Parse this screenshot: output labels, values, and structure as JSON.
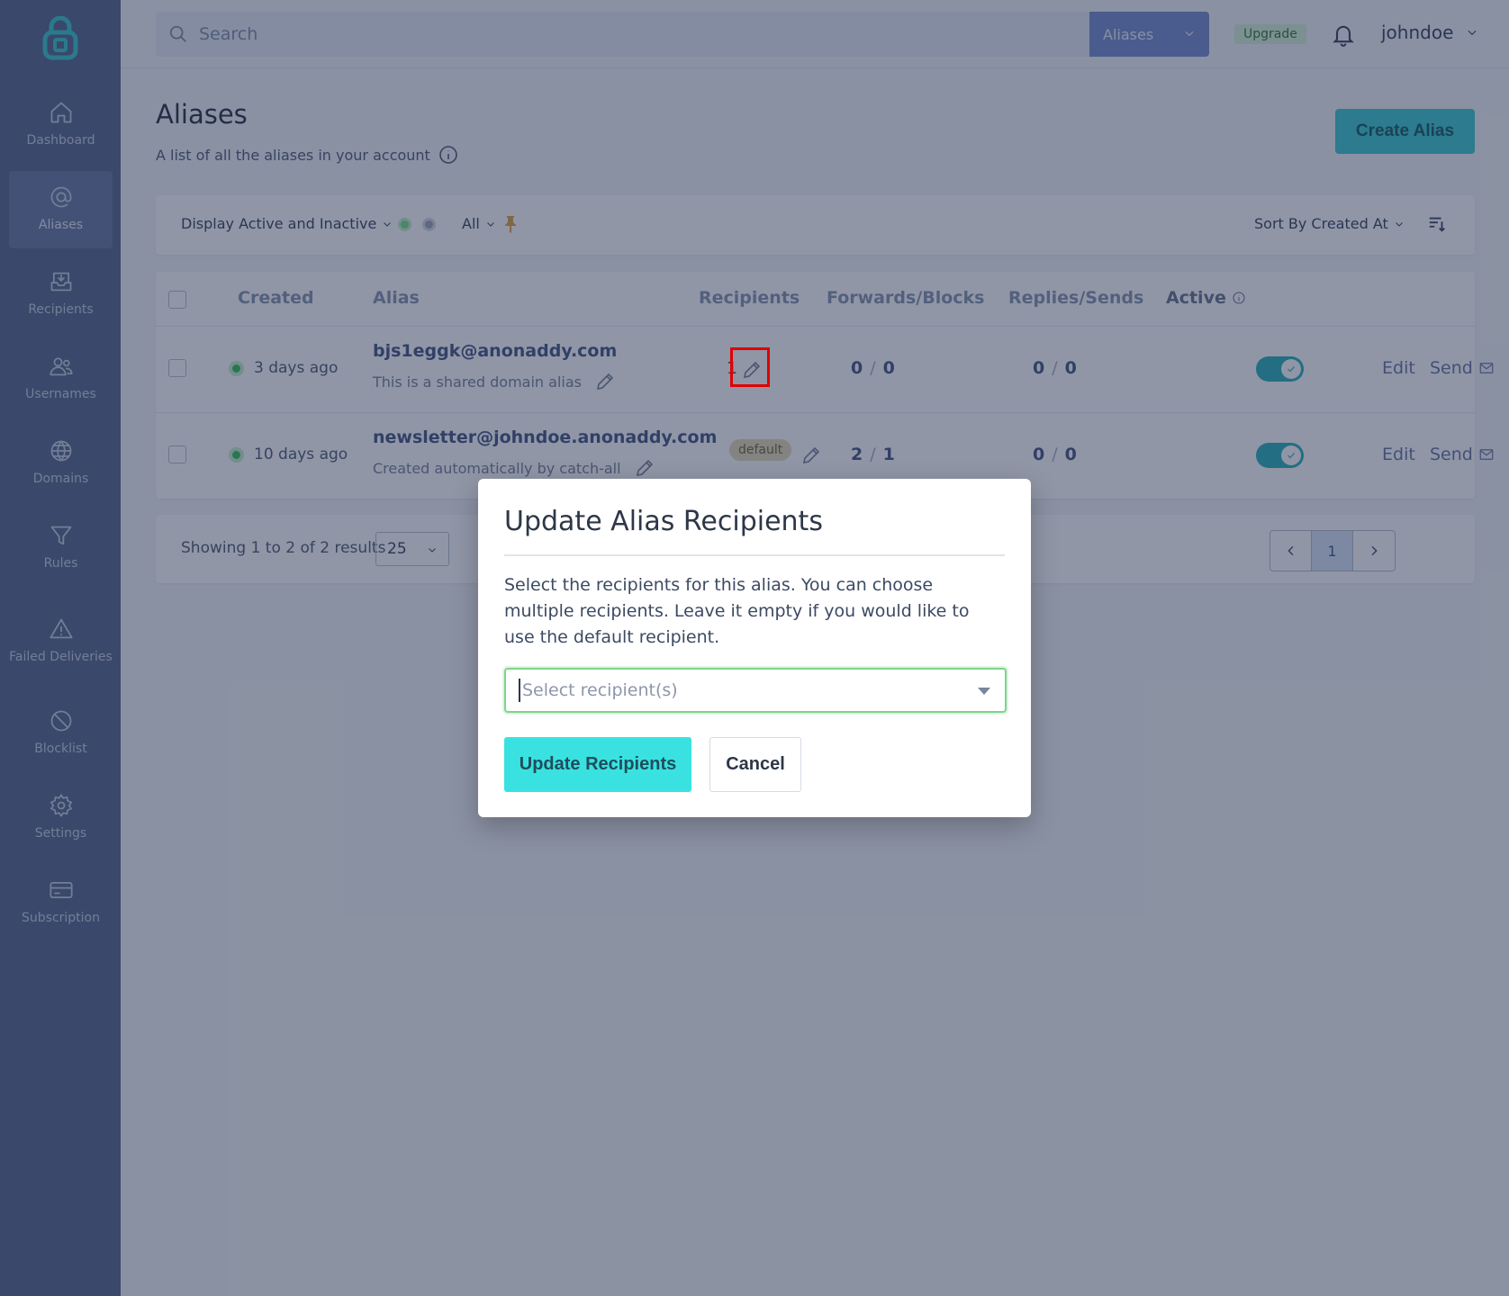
{
  "sidebar": {
    "items": [
      {
        "label": "Dashboard",
        "icon": "home-icon"
      },
      {
        "label": "Aliases",
        "icon": "at-icon"
      },
      {
        "label": "Recipients",
        "icon": "inbox-icon"
      },
      {
        "label": "Usernames",
        "icon": "users-icon"
      },
      {
        "label": "Domains",
        "icon": "globe-icon"
      },
      {
        "label": "Rules",
        "icon": "filter-icon"
      },
      {
        "label": "Failed Deliveries",
        "icon": "warning-icon"
      },
      {
        "label": "Blocklist",
        "icon": "block-icon"
      },
      {
        "label": "Settings",
        "icon": "gear-icon"
      },
      {
        "label": "Subscription",
        "icon": "credit-card-icon"
      }
    ]
  },
  "topbar": {
    "search_placeholder": "Search",
    "search_type": "Aliases",
    "upgrade": "Upgrade",
    "username": "johndoe"
  },
  "page": {
    "title": "Aliases",
    "subtitle": "A list of all the aliases in your account",
    "create_button": "Create Alias"
  },
  "filters": {
    "display": "Display Active and Inactive",
    "all": "All",
    "sort": "Sort By Created At"
  },
  "table": {
    "headers": {
      "created": "Created",
      "alias": "Alias",
      "recipients": "Recipients",
      "forwards_blocks": "Forwards/Blocks",
      "replies_sends": "Replies/Sends",
      "active": "Active"
    },
    "rows": [
      {
        "created": "3 days ago",
        "email": "bjs1eggk@anonaddy.com",
        "description": "This is a shared domain alias",
        "recipients": "1",
        "forwards": "0",
        "blocks": "0",
        "replies": "0",
        "sends": "0",
        "edit": "Edit",
        "send": "Send"
      },
      {
        "created": "10 days ago",
        "email": "newsletter@johndoe.anonaddy.com",
        "description": "Created automatically by catch-all",
        "recipients": "default",
        "forwards": "2",
        "blocks": "1",
        "replies": "0",
        "sends": "0",
        "edit": "Edit",
        "send": "Send"
      }
    ],
    "sep": "/"
  },
  "pagination": {
    "showing": "Showing 1 to 2 of 2 results",
    "per_page": "25",
    "current_page": "1"
  },
  "modal": {
    "title": "Update Alias Recipients",
    "description": "Select the recipients for this alias. You can choose multiple recipients. Leave it empty if you would like to use the default recipient.",
    "select_placeholder": "Select recipient(s)",
    "update_button": "Update Recipients",
    "cancel_button": "Cancel"
  },
  "colors": {
    "sidebar": "#5a6a8f",
    "accent": "#39e2e0",
    "highlight": "#e00000"
  }
}
